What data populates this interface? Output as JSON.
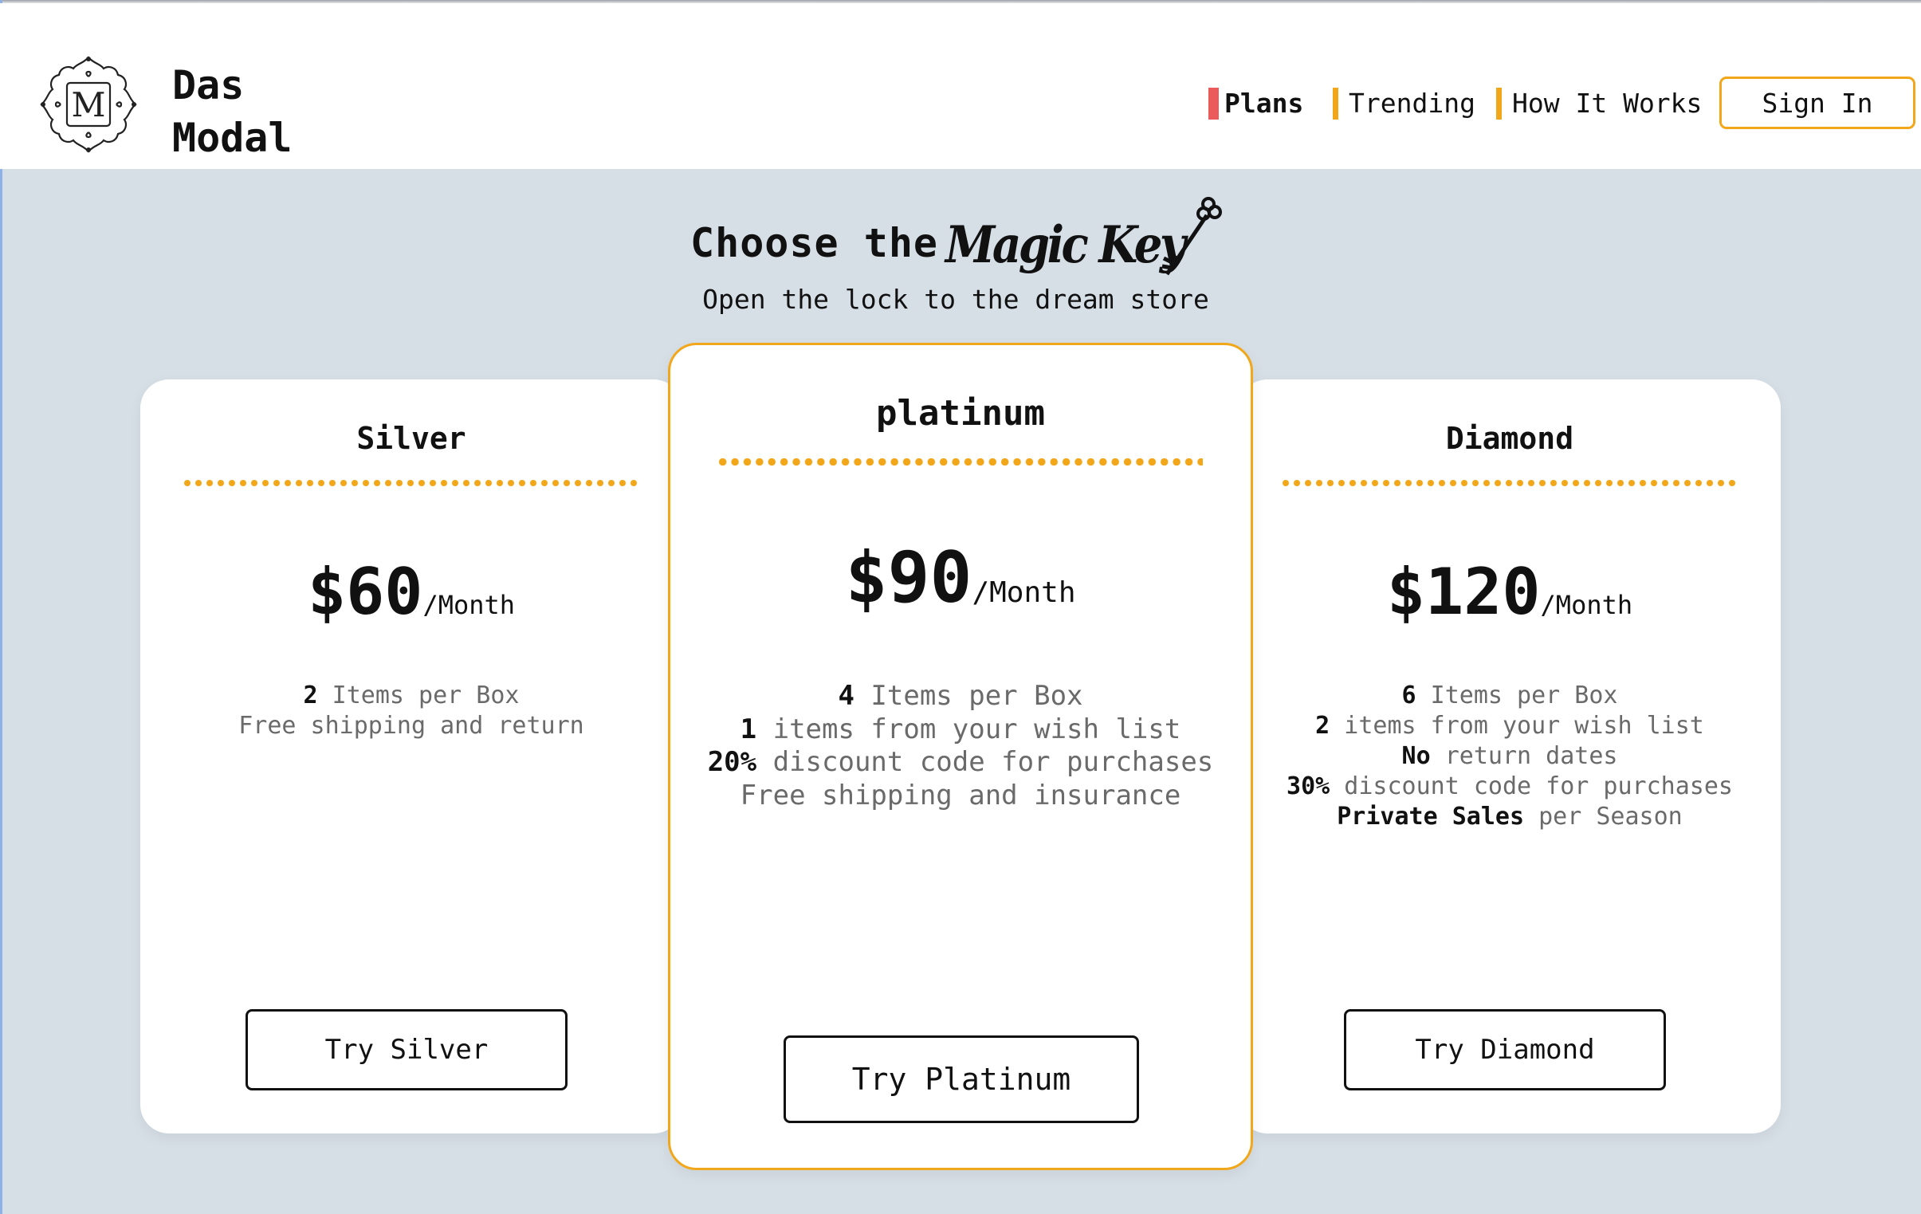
{
  "header": {
    "brand_line1": "Das",
    "brand_line2": "Modal",
    "logo_icon": "monogram-m-logo-icon",
    "nav": [
      {
        "label": "Plans",
        "active": true
      },
      {
        "label": "Trending",
        "active": false
      },
      {
        "label": "How It Works",
        "active": false
      }
    ],
    "signin_label": "Sign In"
  },
  "hero": {
    "title_prefix": "Choose the",
    "title_highlight": "Magic Key",
    "title_icon": "key-icon",
    "subtitle": "Open the lock to the dream store"
  },
  "plans": [
    {
      "name": "Silver",
      "price": "$60",
      "period": "/Month",
      "features": [
        {
          "strong": "2",
          "text": " Items per Box"
        },
        {
          "strong": "",
          "text": "Free shipping and return"
        }
      ],
      "cta": "Try Silver"
    },
    {
      "name": "platinum",
      "price": "$90",
      "period": "/Month",
      "featured": true,
      "features": [
        {
          "strong": "4",
          "text": " Items per Box"
        },
        {
          "strong": "1",
          "text": " items from your wish list"
        },
        {
          "strong": "20%",
          "text": " discount code for purchases"
        },
        {
          "strong": "",
          "text": "Free shipping and insurance"
        }
      ],
      "cta": "Try Platinum"
    },
    {
      "name": "Diamond",
      "price": "$120",
      "period": "/Month",
      "features": [
        {
          "strong": "6",
          "text": " Items per Box"
        },
        {
          "strong": "2",
          "text": " items from your wish list"
        },
        {
          "strong": "No",
          "text": " return dates"
        },
        {
          "strong": "30%",
          "text": " discount code for purchases"
        },
        {
          "strong": "Private Sales",
          "text": " per Season"
        }
      ],
      "cta": "Try Diamond"
    }
  ],
  "colors": {
    "accent": "#f2a71b",
    "active_nav": "#ec5b5b",
    "background": "#d6dee6",
    "card": "#ffffff"
  }
}
